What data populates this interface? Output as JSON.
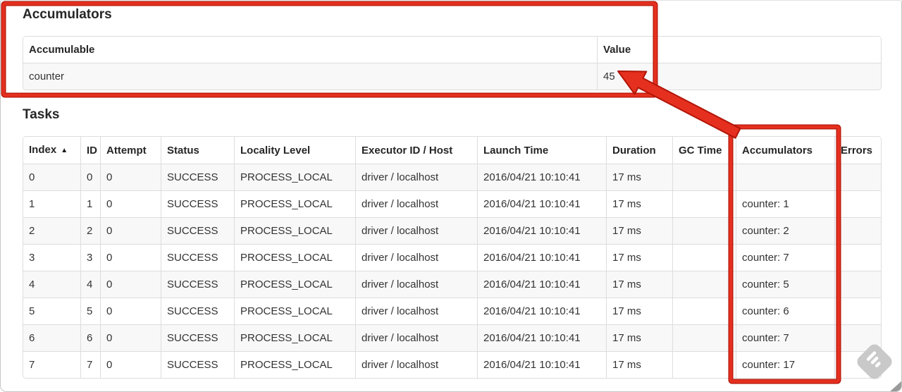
{
  "accumulators_section": {
    "title": "Accumulators",
    "table": {
      "headers": [
        "Accumulable",
        "Value"
      ],
      "rows": [
        [
          "counter",
          "45"
        ]
      ]
    }
  },
  "tasks_section": {
    "title": "Tasks",
    "table": {
      "headers": [
        "Index",
        "ID",
        "Attempt",
        "Status",
        "Locality Level",
        "Executor ID / Host",
        "Launch Time",
        "Duration",
        "GC Time",
        "Accumulators",
        "Errors"
      ],
      "sort_indicator": "▲",
      "rows": [
        [
          "0",
          "0",
          "0",
          "SUCCESS",
          "PROCESS_LOCAL",
          "driver / localhost",
          "2016/04/21 10:10:41",
          "17 ms",
          "",
          "",
          ""
        ],
        [
          "1",
          "1",
          "0",
          "SUCCESS",
          "PROCESS_LOCAL",
          "driver / localhost",
          "2016/04/21 10:10:41",
          "17 ms",
          "",
          "counter: 1",
          ""
        ],
        [
          "2",
          "2",
          "0",
          "SUCCESS",
          "PROCESS_LOCAL",
          "driver / localhost",
          "2016/04/21 10:10:41",
          "17 ms",
          "",
          "counter: 2",
          ""
        ],
        [
          "3",
          "3",
          "0",
          "SUCCESS",
          "PROCESS_LOCAL",
          "driver / localhost",
          "2016/04/21 10:10:41",
          "17 ms",
          "",
          "counter: 7",
          ""
        ],
        [
          "4",
          "4",
          "0",
          "SUCCESS",
          "PROCESS_LOCAL",
          "driver / localhost",
          "2016/04/21 10:10:41",
          "17 ms",
          "",
          "counter: 5",
          ""
        ],
        [
          "5",
          "5",
          "0",
          "SUCCESS",
          "PROCESS_LOCAL",
          "driver / localhost",
          "2016/04/21 10:10:41",
          "17 ms",
          "",
          "counter: 6",
          ""
        ],
        [
          "6",
          "6",
          "0",
          "SUCCESS",
          "PROCESS_LOCAL",
          "driver / localhost",
          "2016/04/21 10:10:41",
          "17 ms",
          "",
          "counter: 7",
          ""
        ],
        [
          "7",
          "7",
          "0",
          "SUCCESS",
          "PROCESS_LOCAL",
          "driver / localhost",
          "2016/04/21 10:10:41",
          "17 ms",
          "",
          "counter: 17",
          ""
        ]
      ]
    }
  },
  "annotations": {
    "highlight_color": "#e5301f",
    "highlight_edge_color": "#b31508"
  },
  "colors": {
    "table_border": "#dddddd",
    "stripe_row": "#f8f8f8",
    "watermark_gray": "#c9c9c9"
  }
}
